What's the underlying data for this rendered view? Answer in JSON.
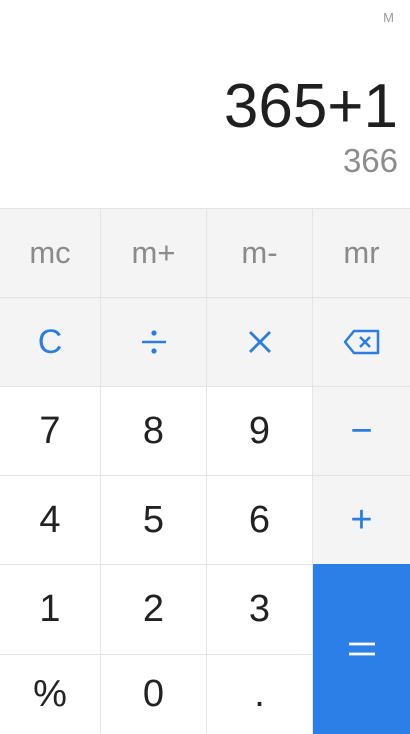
{
  "display": {
    "memory_indicator": "M",
    "expression": "365+1",
    "result": "366"
  },
  "memory_row": {
    "mc": "mc",
    "m_plus": "m+",
    "m_minus": "m-",
    "mr": "mr"
  },
  "function_row": {
    "clear": "C",
    "divide_icon": "divide-icon",
    "multiply_icon": "multiply-icon",
    "backspace_icon": "backspace-icon"
  },
  "digits": {
    "seven": "7",
    "eight": "8",
    "nine": "9",
    "four": "4",
    "five": "5",
    "six": "6",
    "one": "1",
    "two": "2",
    "three": "3",
    "zero": "0"
  },
  "operators": {
    "minus": "−",
    "plus": "+",
    "equals": "=",
    "percent": "%",
    "decimal": "."
  },
  "colors": {
    "accent": "#2a7de1",
    "equals_background": "#2c7fe6",
    "grey_key_background": "#f4f4f4"
  }
}
